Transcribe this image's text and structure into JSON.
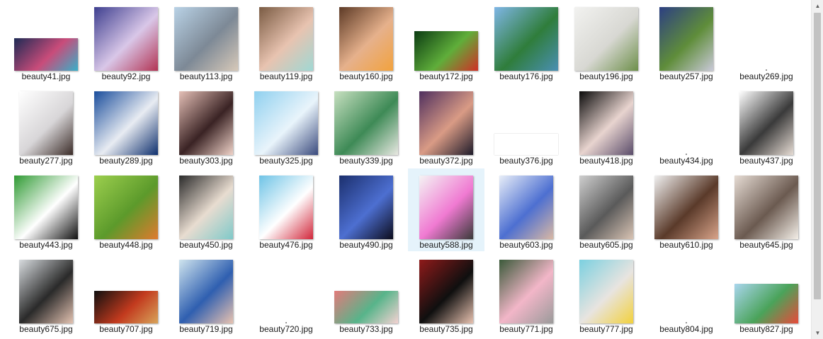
{
  "files": [
    {
      "name": "beauty41.jpg",
      "icon": "image-thumbnail",
      "colors": [
        "#1d2a55",
        "#c94c7a",
        "#38b0c9"
      ],
      "shape": "wide-short"
    },
    {
      "name": "beauty92.jpg",
      "icon": "image-thumbnail",
      "colors": [
        "#3e3f8f",
        "#d9c7e8",
        "#b23353"
      ],
      "shape": "square"
    },
    {
      "name": "beauty113.jpg",
      "icon": "image-thumbnail",
      "colors": [
        "#b9d2e6",
        "#7d8996",
        "#d7c9b9"
      ],
      "shape": "wide"
    },
    {
      "name": "beauty119.jpg",
      "icon": "image-thumbnail",
      "colors": [
        "#7a5b43",
        "#e8c3b0",
        "#9fd8d4"
      ],
      "shape": "narrow"
    },
    {
      "name": "beauty160.jpg",
      "icon": "image-thumbnail",
      "colors": [
        "#5d3a26",
        "#e6b18c",
        "#f2a23d"
      ],
      "shape": "narrow"
    },
    {
      "name": "beauty172.jpg",
      "icon": "image-thumbnail",
      "colors": [
        "#0b3b12",
        "#5fae3a",
        "#d12f26"
      ],
      "shape": "wide-mid"
    },
    {
      "name": "beauty176.jpg",
      "icon": "image-thumbnail",
      "colors": [
        "#7fb6e6",
        "#2f7d3b",
        "#4a8fb3"
      ],
      "shape": "wide"
    },
    {
      "name": "beauty196.jpg",
      "icon": "image-thumbnail",
      "colors": [
        "#f2f2f0",
        "#d8d8d3",
        "#6d8f4a"
      ],
      "shape": "wide"
    },
    {
      "name": "beauty257.jpg",
      "icon": "image-thumbnail",
      "colors": [
        "#2c3f82",
        "#5f8d3a",
        "#c9c9d8"
      ],
      "shape": "narrow"
    },
    {
      "name": "beauty269.jpg",
      "icon": "image-thumbnail",
      "colors": [],
      "shape": "dot"
    },
    {
      "name": "beauty277.jpg",
      "icon": "image-thumbnail",
      "colors": [
        "#ffffff",
        "#d8d6d8",
        "#3b2c28"
      ],
      "shape": "narrow"
    },
    {
      "name": "beauty289.jpg",
      "icon": "image-thumbnail",
      "colors": [
        "#1a4d9c",
        "#e8ecf2",
        "#0e2f6d"
      ],
      "shape": "wide"
    },
    {
      "name": "beauty303.jpg",
      "icon": "image-thumbnail",
      "colors": [
        "#e4bfb6",
        "#3a2324",
        "#f0d3c9"
      ],
      "shape": "narrow"
    },
    {
      "name": "beauty325.jpg",
      "icon": "image-thumbnail",
      "colors": [
        "#8fd0ef",
        "#e9f4fb",
        "#3a4a7d"
      ],
      "shape": "wide"
    },
    {
      "name": "beauty339.jpg",
      "icon": "image-thumbnail",
      "colors": [
        "#c7e0c0",
        "#3e8a56",
        "#e8e8e2"
      ],
      "shape": "wide"
    },
    {
      "name": "beauty372.jpg",
      "icon": "image-thumbnail",
      "colors": [
        "#4f2f5e",
        "#d99b85",
        "#1e1b2a"
      ],
      "shape": "narrow"
    },
    {
      "name": "beauty376.jpg",
      "icon": "image-thumbnail",
      "colors": [
        "#ffffff"
      ],
      "shape": "blank"
    },
    {
      "name": "beauty418.jpg",
      "icon": "image-thumbnail",
      "colors": [
        "#0a0a0a",
        "#e8d4cf",
        "#5a4c6a"
      ],
      "shape": "narrow"
    },
    {
      "name": "beauty434.jpg",
      "icon": "image-thumbnail",
      "colors": [],
      "shape": "dot"
    },
    {
      "name": "beauty437.jpg",
      "icon": "image-thumbnail",
      "colors": [
        "#ffffff",
        "#3a3a3a",
        "#e6dcd4"
      ],
      "shape": "narrow"
    },
    {
      "name": "beauty443.jpg",
      "icon": "image-thumbnail",
      "colors": [
        "#2f9a33",
        "#ffffff",
        "#0f0f0f"
      ],
      "shape": "wide"
    },
    {
      "name": "beauty448.jpg",
      "icon": "image-thumbnail",
      "colors": [
        "#9ccf4e",
        "#5c9a2b",
        "#e07a2e"
      ],
      "shape": "wide"
    },
    {
      "name": "beauty450.jpg",
      "icon": "image-thumbnail",
      "colors": [
        "#2a2a2a",
        "#e8dcd0",
        "#7fc9c9"
      ],
      "shape": "narrow"
    },
    {
      "name": "beauty476.jpg",
      "icon": "image-thumbnail",
      "colors": [
        "#6ec3e6",
        "#ffffff",
        "#d1263a"
      ],
      "shape": "narrow"
    },
    {
      "name": "beauty490.jpg",
      "icon": "image-thumbnail",
      "colors": [
        "#1b2f6d",
        "#4d6fd1",
        "#0c0c1c"
      ],
      "shape": "narrow"
    },
    {
      "name": "beauty588.jpg",
      "icon": "image-thumbnail",
      "colors": [
        "#f4f4f4",
        "#f07ad2",
        "#3a3a3a"
      ],
      "shape": "narrow",
      "selected": true
    },
    {
      "name": "beauty603.jpg",
      "icon": "image-thumbnail",
      "colors": [
        "#e8eef8",
        "#4d6fd1",
        "#d9b8a4"
      ],
      "shape": "narrow"
    },
    {
      "name": "beauty605.jpg",
      "icon": "image-thumbnail",
      "colors": [
        "#cfcfcf",
        "#5a5a5a",
        "#d9c4b4"
      ],
      "shape": "narrow"
    },
    {
      "name": "beauty610.jpg",
      "icon": "image-thumbnail",
      "colors": [
        "#f1f1f1",
        "#5a3a2a",
        "#d9a48a"
      ],
      "shape": "wide"
    },
    {
      "name": "beauty645.jpg",
      "icon": "image-thumbnail",
      "colors": [
        "#e6dcd4",
        "#6b5a50",
        "#f4efe8"
      ],
      "shape": "wide"
    },
    {
      "name": "beauty675.jpg",
      "icon": "image-thumbnail",
      "colors": [
        "#d8dcdf",
        "#2a2a2a",
        "#e3c2b1"
      ],
      "shape": "narrow"
    },
    {
      "name": "beauty707.jpg",
      "icon": "image-thumbnail",
      "colors": [
        "#0f0f0f",
        "#c23a1e",
        "#d8a45a"
      ],
      "shape": "wide-short"
    },
    {
      "name": "beauty719.jpg",
      "icon": "image-thumbnail",
      "colors": [
        "#cfe4ee",
        "#2f5fb0",
        "#e8c2b0"
      ],
      "shape": "narrow"
    },
    {
      "name": "beauty720.jpg",
      "icon": "image-thumbnail",
      "colors": [],
      "shape": "dot"
    },
    {
      "name": "beauty733.jpg",
      "icon": "image-thumbnail",
      "colors": [
        "#e37a7a",
        "#57b48a",
        "#f4d2d2"
      ],
      "shape": "wide-short"
    },
    {
      "name": "beauty735.jpg",
      "icon": "image-thumbnail",
      "colors": [
        "#8f1a1a",
        "#0f0f0f",
        "#e8c2b0"
      ],
      "shape": "narrow"
    },
    {
      "name": "beauty771.jpg",
      "icon": "image-thumbnail",
      "colors": [
        "#3b5a3a",
        "#f2b6c8",
        "#9a9a9a"
      ],
      "shape": "narrow"
    },
    {
      "name": "beauty777.jpg",
      "icon": "image-thumbnail",
      "colors": [
        "#7bd0e0",
        "#e8e4e0",
        "#f2d13d"
      ],
      "shape": "narrow"
    },
    {
      "name": "beauty804.jpg",
      "icon": "image-thumbnail",
      "colors": [],
      "shape": "dot"
    },
    {
      "name": "beauty827.jpg",
      "icon": "image-thumbnail",
      "colors": [
        "#a9d6ee",
        "#4aa35a",
        "#e84a3a"
      ],
      "shape": "wide-mid"
    }
  ],
  "scrollbar": {
    "up_icon": "scroll-up-icon",
    "down_icon": "scroll-down-icon",
    "up_glyph": "▲",
    "down_glyph": "▼"
  }
}
